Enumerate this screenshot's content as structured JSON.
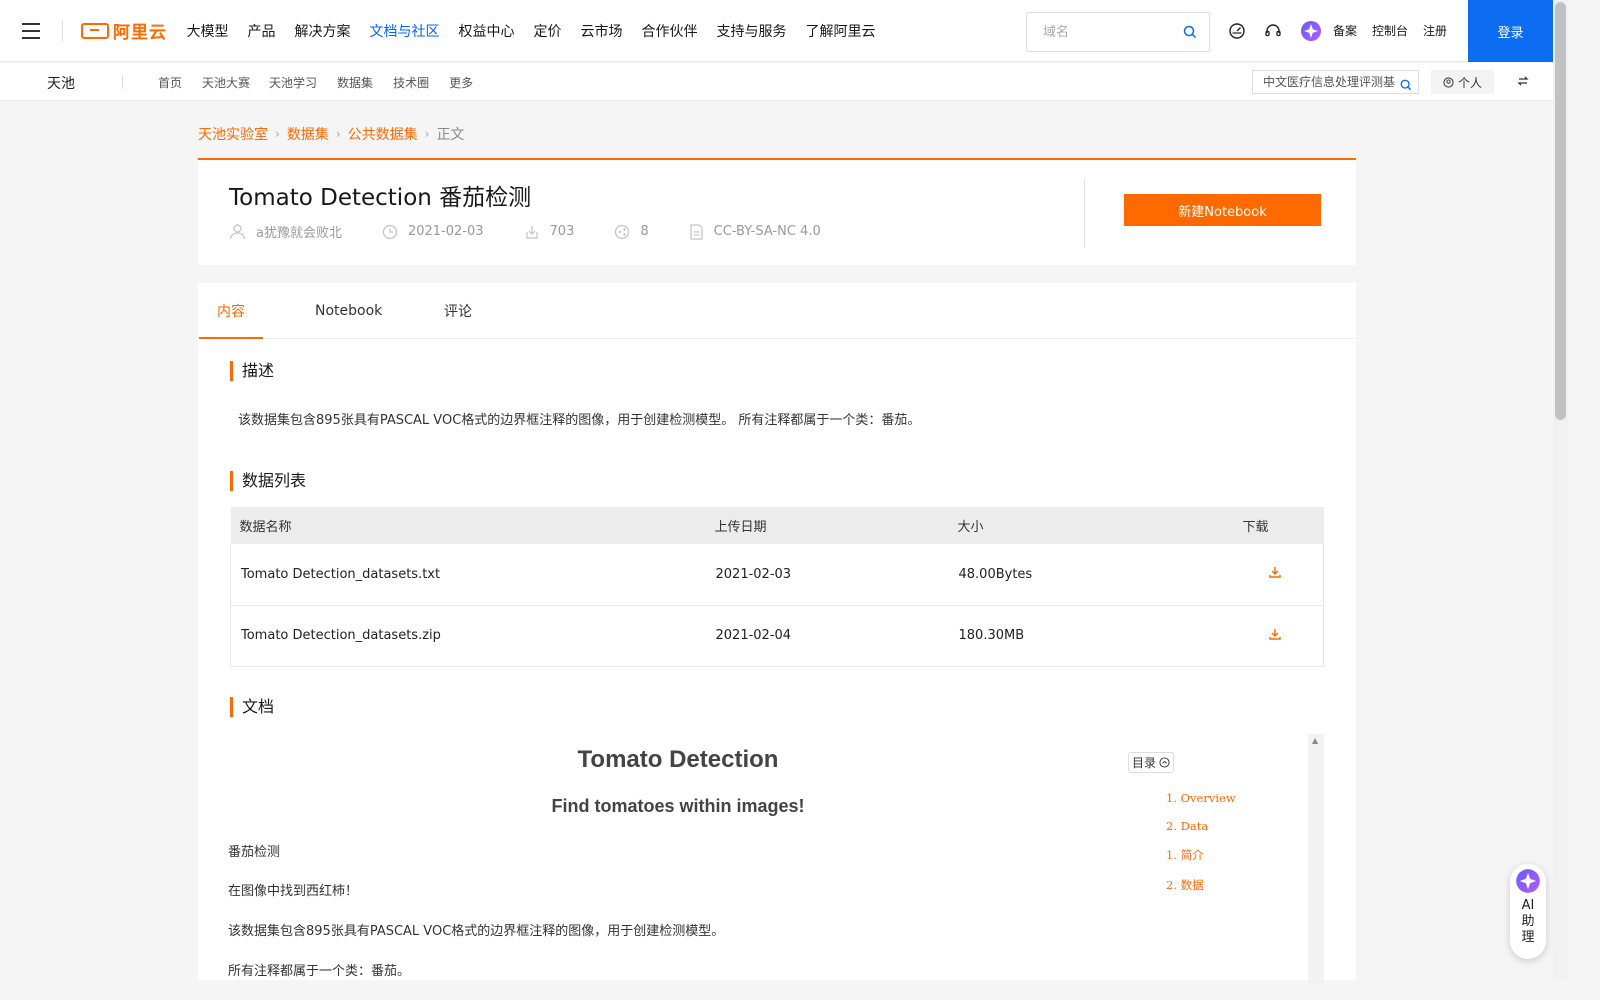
{
  "topnav": {
    "logo_text": "阿里云",
    "menu": [
      "大模型",
      "产品",
      "解决方案",
      "文档与社区",
      "权益中心",
      "定价",
      "云市场",
      "合作伙伴",
      "支持与服务",
      "了解阿里云"
    ],
    "active_menu_index": 3,
    "search_placeholder": "域名",
    "links": [
      "备案",
      "控制台",
      "注册"
    ],
    "login_label": "登录"
  },
  "subnav": {
    "brand": "天池",
    "items": [
      "首页",
      "天池大赛",
      "天池学习",
      "数据集",
      "技术圈",
      "更多"
    ],
    "quick_search": "中文医疗信息处理评测基",
    "personal_label": "个人"
  },
  "breadcrumb": [
    "天池实验室",
    "数据集",
    "公共数据集",
    "正文"
  ],
  "dataset": {
    "title": "Tomato Detection 番茄检测",
    "author": "a犹豫就会败北",
    "date": "2021-02-03",
    "downloads": "703",
    "shares": "8",
    "license": "CC-BY-SA-NC 4.0",
    "new_notebook_label": "新建Notebook"
  },
  "tabs": [
    "内容",
    "Notebook",
    "评论"
  ],
  "active_tab": 0,
  "sections": {
    "description_title": "描述",
    "description_text": "该数据集包含895张具有PASCAL VOC格式的边界框注释的图像，用于创建检测模型。 所有注释都属于一个类：番茄。",
    "files_title": "数据列表",
    "docs_title": "文档"
  },
  "file_table": {
    "headers": [
      "数据名称",
      "上传日期",
      "大小",
      "下载"
    ],
    "rows": [
      {
        "name": "Tomato Detection_datasets.txt",
        "date": "2021-02-03",
        "size": "48.00Bytes"
      },
      {
        "name": "Tomato Detection_datasets.zip",
        "date": "2021-02-04",
        "size": "180.30MB"
      }
    ]
  },
  "doc": {
    "title": "Tomato Detection",
    "subtitle": "Find tomatoes within images!",
    "paragraphs": [
      "番茄检测",
      "在图像中找到西红柿！",
      "该数据集包含895张具有PASCAL VOC格式的边界框注释的图像，用于创建检测模型。",
      "所有注释都属于一个类：番茄。"
    ],
    "toc_label": "目录",
    "toc": [
      "1. Overview",
      "2. Data",
      "1. 简介",
      "2. 数据"
    ]
  },
  "ai_assistant": {
    "label": "AI助理"
  },
  "colors": {
    "accent": "#ff6a00",
    "link_blue": "#0066ff",
    "login_blue": "#0c6cf2"
  },
  "icons": [
    "menu-icon",
    "search-icon",
    "dashboard-icon",
    "headset-icon",
    "ai-star-icon",
    "user-icon",
    "clock-icon",
    "download-icon",
    "share-icon",
    "document-icon",
    "swap-icon"
  ]
}
